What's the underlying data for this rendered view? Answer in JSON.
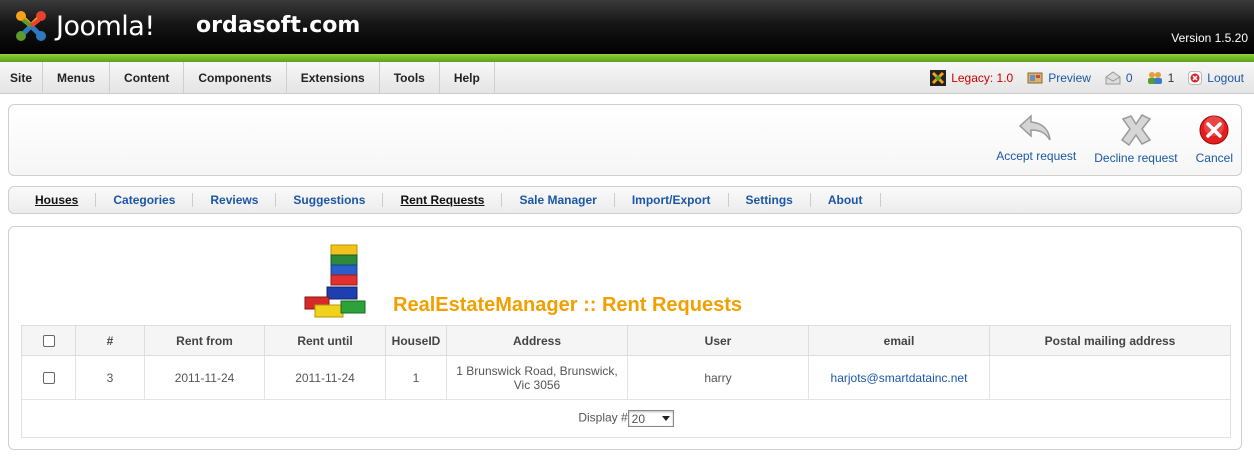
{
  "header": {
    "logo_text": "Joomla!",
    "site_name": "ordasoft.com",
    "version": "Version 1.5.20"
  },
  "menu": {
    "items": [
      {
        "label": "Site"
      },
      {
        "label": "Menus"
      },
      {
        "label": "Content"
      },
      {
        "label": "Components"
      },
      {
        "label": "Extensions"
      },
      {
        "label": "Tools"
      },
      {
        "label": "Help"
      }
    ]
  },
  "status": {
    "legacy": "Legacy: 1.0",
    "preview": "Preview",
    "messages_count": "0",
    "users_count": "1",
    "logout": "Logout"
  },
  "toolbar": {
    "accept": "Accept request",
    "decline": "Decline request",
    "cancel": "Cancel"
  },
  "submenu": {
    "items": [
      {
        "label": "Houses"
      },
      {
        "label": "Categories"
      },
      {
        "label": "Reviews"
      },
      {
        "label": "Suggestions"
      },
      {
        "label": "Rent Requests"
      },
      {
        "label": "Sale Manager"
      },
      {
        "label": "Import/Export"
      },
      {
        "label": "Settings"
      },
      {
        "label": "About"
      }
    ]
  },
  "main": {
    "heading": "RealEstateManager :: Rent Requests",
    "columns": [
      "#",
      "Rent from",
      "Rent until",
      "HouseID",
      "Address",
      "User",
      "email",
      "Postal mailing address"
    ],
    "rows": [
      {
        "num": "3",
        "rent_from": "2011-11-24",
        "rent_until": "2011-11-24",
        "house_id": "1",
        "address": "1 Brunswick Road, Brunswick, Vic 3056",
        "user": "harry",
        "email": "harjots@smartdatainc.net",
        "postal": ""
      }
    ],
    "display_label": "Display #",
    "display_value": "20"
  },
  "colors": {
    "accent_orange": "#f0a000",
    "link_blue": "#1b57a6",
    "header_green": "#6cb52a"
  }
}
